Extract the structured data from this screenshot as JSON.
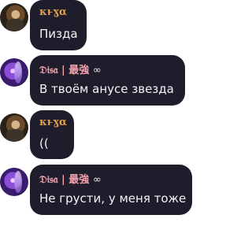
{
  "messages": [
    {
      "author": "κͱɣα",
      "text": "Пизда",
      "avatar_icon": "portrait-avatar-icon"
    },
    {
      "author": "𝔇𝔦𝔰𝔞 | 最強",
      "author_suffix": "∞",
      "text": "В твоём анусе звезда",
      "avatar_icon": "purple-anime-avatar-icon"
    },
    {
      "author": "κͱɣα",
      "text": "((",
      "avatar_icon": "portrait-avatar-icon"
    },
    {
      "author": "𝔇𝔦𝔰𝔞 | 最強",
      "author_suffix": "∞",
      "text": "Не грусти, у меня тоже",
      "avatar_icon": "purple-anime-avatar-icon"
    }
  ],
  "colors": {
    "bubble": "#1f1d2b",
    "name_kura": "#e2a24a",
    "name_disa": "#f3a2ac",
    "text": "#f4f4f6"
  }
}
